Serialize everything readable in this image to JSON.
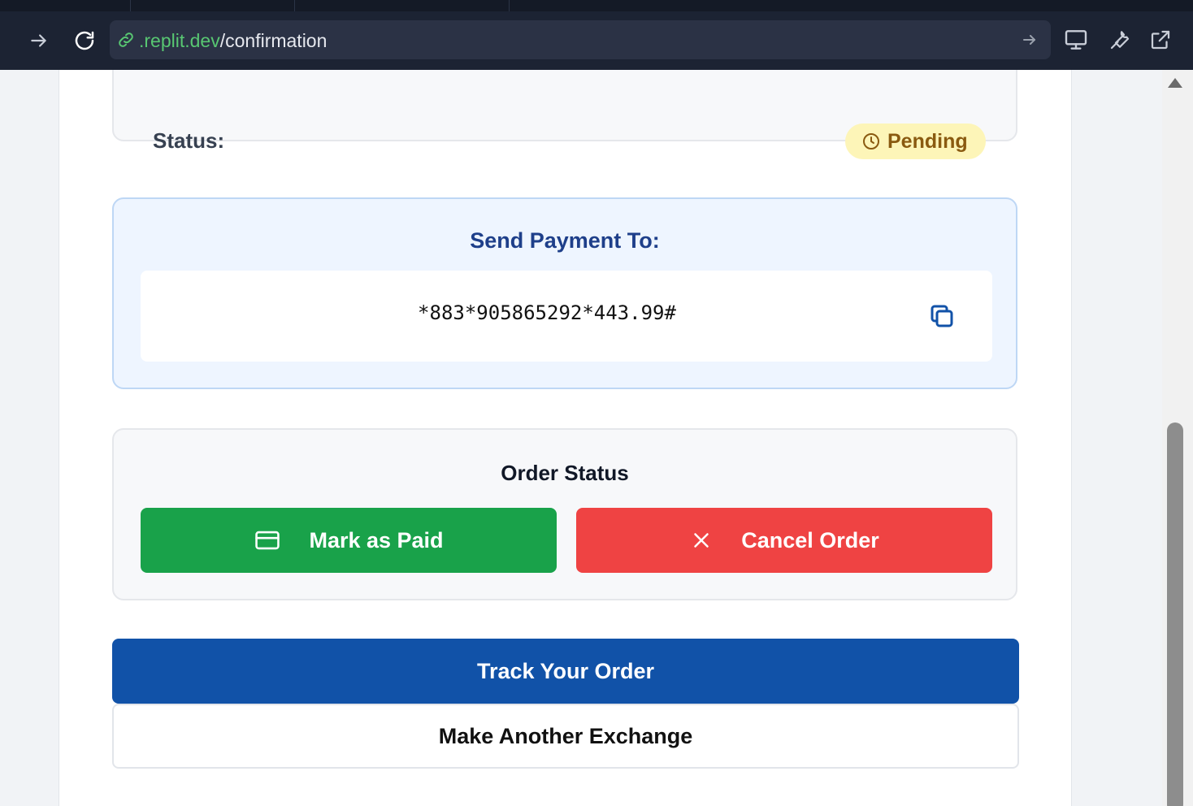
{
  "browser": {
    "address": {
      "domain": ".replit.dev",
      "path": "/confirmation"
    },
    "icons": [
      "forward-icon",
      "reload-icon",
      "link-icon",
      "go-arrow-icon",
      "devices-icon",
      "wrench-icon",
      "open-external-icon"
    ]
  },
  "status": {
    "label": "Status:",
    "badge": "Pending",
    "badge_icon": "clock-icon"
  },
  "payment": {
    "title": "Send Payment To:",
    "code": "*883*905865292*443.99#",
    "copy_icon": "copy-icon"
  },
  "order_status": {
    "title": "Order Status",
    "mark_paid_label": "Mark as Paid",
    "cancel_label": "Cancel Order"
  },
  "actions": {
    "track_label": "Track Your Order",
    "another_label": "Make Another Exchange"
  },
  "colors": {
    "chrome": "#1c2333",
    "url_domain": "#58c772",
    "pending_bg": "#fdf5b8",
    "pending_text": "#8a5a10",
    "payment_bg": "#eef5ff",
    "payment_title": "#1e3f8a",
    "mark_paid": "#19a24a",
    "cancel": "#ef4343",
    "track": "#1152a8"
  }
}
